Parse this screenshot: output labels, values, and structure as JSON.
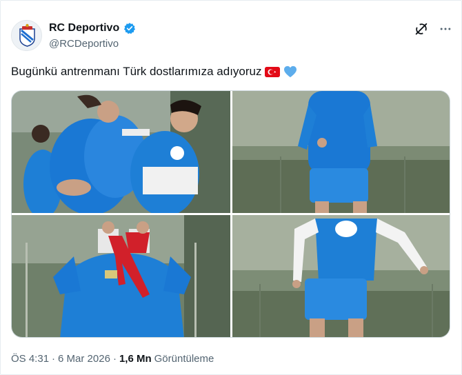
{
  "author": {
    "display_name": "RC Deportivo",
    "handle": "@RCDeportivo",
    "verified_icon": "verified-badge-icon",
    "brand_color": "#1d9bf0"
  },
  "tweet": {
    "text": "Bugünkü antrenmanı Türk dostlarımıza adıyoruz",
    "emojis": [
      "turkey-flag",
      "blue-heart"
    ]
  },
  "media": {
    "photos": [
      {
        "name": "photo-1"
      },
      {
        "name": "photo-2"
      },
      {
        "name": "photo-3"
      },
      {
        "name": "photo-4"
      }
    ]
  },
  "meta": {
    "time": "ÖS 4:31",
    "sep1": "·",
    "date": "6 Mar 2026",
    "sep2": "·",
    "views_count": "1,6 Mn",
    "views_label": "Görüntüleme"
  },
  "colors": {
    "text_primary": "#0f1419",
    "text_secondary": "#536471",
    "kit_blue": "#1e7fd6"
  }
}
